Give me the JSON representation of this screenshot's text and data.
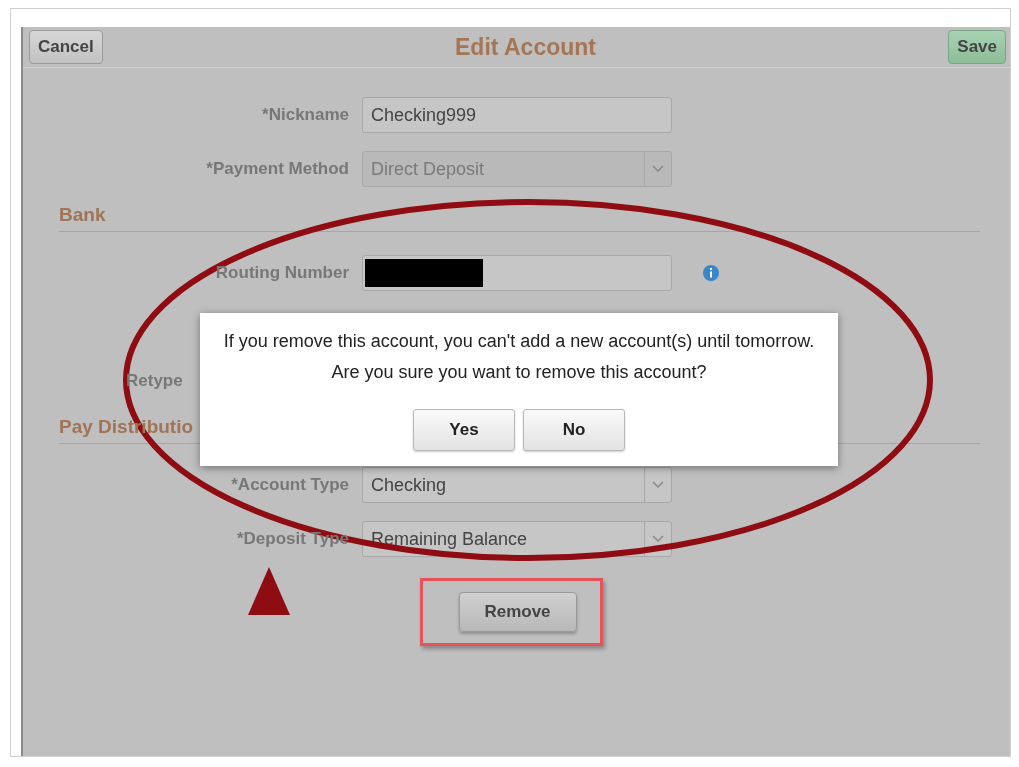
{
  "header": {
    "cancel": "Cancel",
    "title": "Edit Account",
    "save": "Save"
  },
  "fields": [
    {
      "label": "*Nickname",
      "value": "Checking999",
      "kind": "text",
      "disabled": false
    },
    {
      "label": "*Payment Method",
      "value": "Direct Deposit",
      "kind": "select",
      "disabled": true
    }
  ],
  "sections": [
    {
      "title": "Bank",
      "rows": [
        {
          "label": "Routing Number",
          "kind": "redacted",
          "info": true
        },
        {
          "kind": "covered"
        },
        {
          "label": "Retype",
          "kind": "label_only"
        }
      ]
    },
    {
      "title": "Pay Distributio",
      "rows": [
        {
          "label": "*Account Type",
          "value": "Checking",
          "kind": "select"
        },
        {
          "label": "*Deposit Type",
          "value": "Remaining Balance",
          "kind": "select"
        }
      ]
    }
  ],
  "remove_button": "Remove",
  "dialog": {
    "lines": [
      "If you remove this account, you can't add a new account(s) until tomorrow.",
      "Are you sure you want to remove this account?"
    ],
    "buttons": [
      "Yes",
      "No"
    ]
  }
}
